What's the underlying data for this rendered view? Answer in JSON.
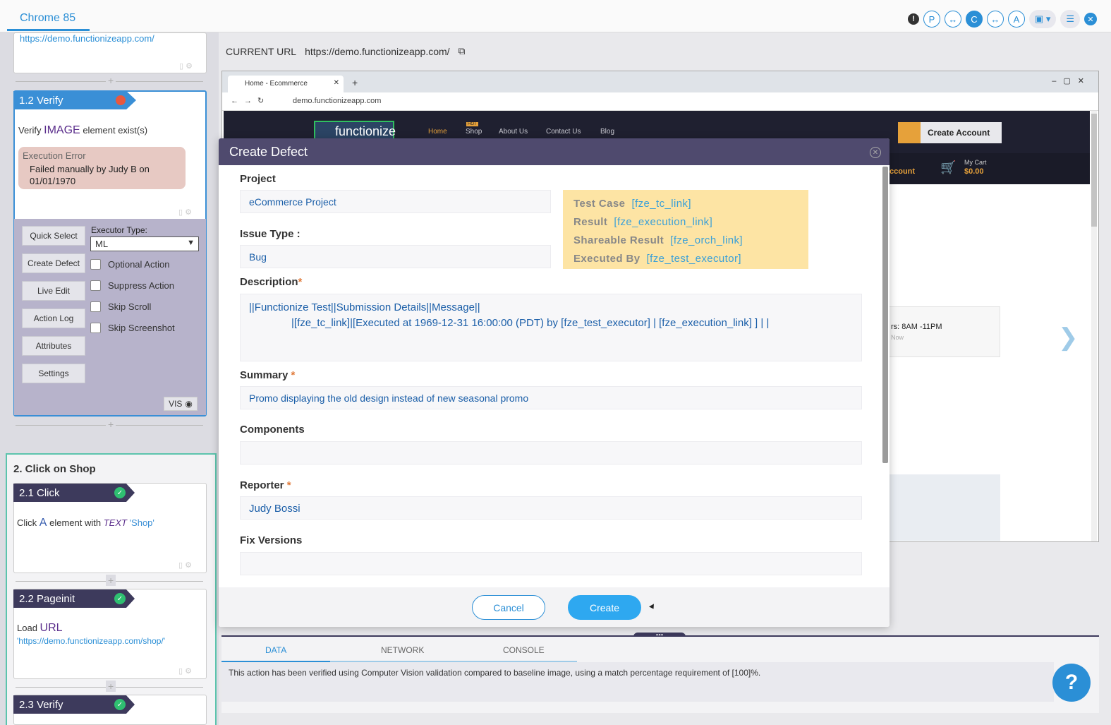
{
  "topbar": {
    "tab_label": "Chrome 85",
    "icons": [
      "alert-icon",
      "P",
      "C",
      "A"
    ],
    "alert": "!",
    "p": "P",
    "c": "C",
    "a": "A",
    "swap": "↔"
  },
  "left": {
    "prev_url": "https://demo.functionizeapp.com/",
    "step12": {
      "tag": "1.2 Verify",
      "verify_word": "Verify",
      "verify_type": "IMAGE",
      "verify_rest": "element exist(s)",
      "error_title": "Execution Error",
      "error_msg": "Failed manually by Judy B on 01/01/1970"
    },
    "buttons": [
      "Quick Select",
      "Create Defect",
      "Live Edit",
      "Action Log",
      "Attributes",
      "Settings"
    ],
    "executor_label": "Executor Type:",
    "executor_value": "ML",
    "options": [
      "Optional Action",
      "Suppress Action",
      "Skip Scroll",
      "Skip Screenshot"
    ],
    "vis_label": "VIS",
    "section2_title": "2. Click on Shop",
    "step21": {
      "tag": "2.1 Click",
      "pre": "Click",
      "el": "A",
      "mid": "element with",
      "attr": "TEXT",
      "val": "'Shop'"
    },
    "step22": {
      "tag": "2.2 Pageinit",
      "pre": "Load",
      "el": "URL",
      "url": "'https://demo.functionizeapp.com/shop/'"
    },
    "step23": {
      "tag": "2.3 Verify"
    }
  },
  "main": {
    "url_label": "CURRENT URL",
    "url_value": "https://demo.functionizeapp.com/",
    "browser": {
      "tab_title": "Home - Ecommerce",
      "address": "demo.functionizeapp.com",
      "logo": "functionize",
      "nav": [
        "Home",
        "Shop",
        "About Us",
        "Contact Us",
        "Blog"
      ],
      "hot": "HOT",
      "create_account": "Create Account",
      "account": "ccount",
      "cart_label": "My Cart",
      "cart_value": "$0.00",
      "hours": "rs: 8AM -11PM",
      "hours_sub": "Now"
    },
    "console": {
      "tabs": [
        "DATA",
        "NETWORK",
        "CONSOLE"
      ],
      "message": "This action has been verified using Computer Vision validation compared to baseline image, using a match percentage requirement of [100]%."
    },
    "help": "?"
  },
  "modal": {
    "title": "Create Defect",
    "project_label": "Project",
    "project_value": "eCommerce Project",
    "issue_label": "Issue Type :",
    "issue_value": "Bug",
    "info": [
      {
        "k": "Test Case",
        "v": "[fze_tc_link]"
      },
      {
        "k": "Result",
        "v": "[fze_execution_link]"
      },
      {
        "k": "Shareable Result",
        "v": "[fze_orch_link]"
      },
      {
        "k": "Executed By",
        "v": "[fze_test_executor]"
      }
    ],
    "description_label": "Description",
    "description_line1": "||Functionize Test||Submission Details||Message||",
    "description_line2": "|[fze_tc_link]|[Executed at 1969-12-31 16:00:00 (PDT) by [fze_test_executor] | [fze_execution_link] ] | |",
    "summary_label": "Summary",
    "summary_value": "Promo displaying the old design instead of new seasonal promo",
    "components_label": "Components",
    "components_value": "",
    "reporter_label": "Reporter",
    "reporter_value": "Judy Bossi",
    "fix_label": "Fix Versions",
    "fix_value": "",
    "required": "*",
    "cancel": "Cancel",
    "create": "Create"
  }
}
